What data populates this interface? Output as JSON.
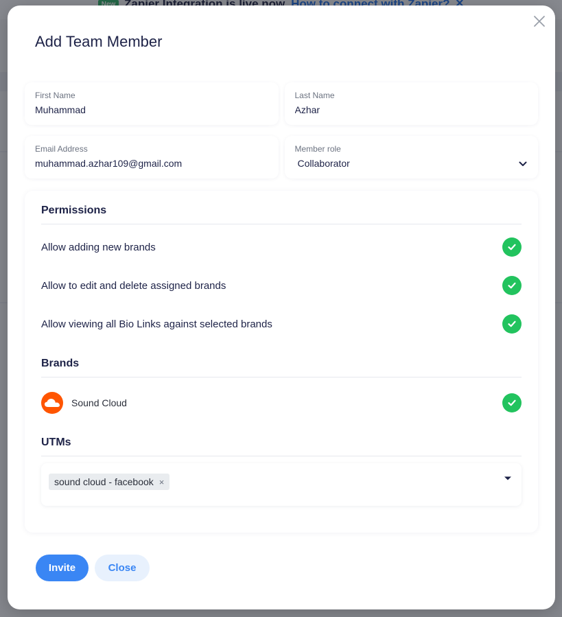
{
  "background": {
    "banner_badge": "New",
    "banner_text": "Zapier Integration is live now.",
    "banner_link": "How to connect with Zapier?"
  },
  "modal": {
    "title": "Add Team Member",
    "fields": {
      "first_name": {
        "label": "First Name",
        "value": "Muhammad"
      },
      "last_name": {
        "label": "Last Name",
        "value": "Azhar"
      },
      "email": {
        "label": "Email Address",
        "value": "muhammad.azhar109@gmail.com"
      },
      "member_role": {
        "label": "Member role",
        "value": "Collaborator"
      }
    },
    "permissions": {
      "title": "Permissions",
      "items": [
        {
          "label": "Allow adding new brands",
          "checked": true
        },
        {
          "label": "Allow to edit and delete assigned brands",
          "checked": true
        },
        {
          "label": "Allow viewing all Bio Links against selected brands",
          "checked": true
        }
      ]
    },
    "brands": {
      "title": "Brands",
      "items": [
        {
          "name": "Sound Cloud",
          "icon": "soundcloud-logo",
          "checked": true
        }
      ]
    },
    "utms": {
      "title": "UTMs",
      "tags": [
        "sound cloud - facebook"
      ],
      "remove_glyph": "×"
    },
    "buttons": {
      "invite": "Invite",
      "close": "Close"
    }
  },
  "colors": {
    "accent": "#3a86f4",
    "check": "#22c35e",
    "title": "#1d2247",
    "soundcloud": "#ff5500"
  }
}
